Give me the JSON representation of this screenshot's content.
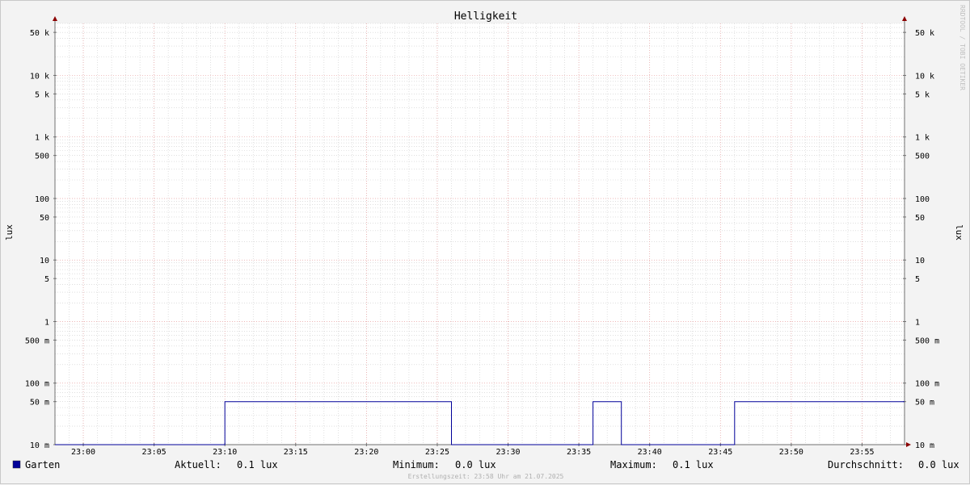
{
  "chart_data": {
    "type": "line",
    "title": "Helligkeit",
    "ylabel": "lux",
    "yscale": "log",
    "ylim": [
      0.01,
      70000
    ],
    "grid": true,
    "y_tick_labels": [
      {
        "value": 50000,
        "label": "50 k"
      },
      {
        "value": 10000,
        "label": "10 k"
      },
      {
        "value": 5000,
        "label": "5 k"
      },
      {
        "value": 1000,
        "label": "1 k"
      },
      {
        "value": 500,
        "label": "500"
      },
      {
        "value": 100,
        "label": "100"
      },
      {
        "value": 50,
        "label": "50"
      },
      {
        "value": 10,
        "label": "10"
      },
      {
        "value": 5,
        "label": "5"
      },
      {
        "value": 1,
        "label": "1"
      },
      {
        "value": 0.5,
        "label": "500 m"
      },
      {
        "value": 0.1,
        "label": "100 m"
      },
      {
        "value": 0.05,
        "label": "50 m"
      },
      {
        "value": 0.01,
        "label": "10 m"
      }
    ],
    "x_tick_labels": [
      "23:00",
      "23:05",
      "23:10",
      "23:15",
      "23:20",
      "23:25",
      "23:30",
      "23:35",
      "23:40",
      "23:45",
      "23:50",
      "23:55"
    ],
    "series": [
      {
        "name": "Garten",
        "color": "#000099",
        "points": [
          [
            "22:58",
            0.01
          ],
          [
            "23:10",
            0.01
          ],
          [
            "23:10",
            0.05
          ],
          [
            "23:26",
            0.05
          ],
          [
            "23:26",
            0.01
          ],
          [
            "23:36",
            0.01
          ],
          [
            "23:36",
            0.05
          ],
          [
            "23:38",
            0.05
          ],
          [
            "23:38",
            0.01
          ],
          [
            "23:46",
            0.01
          ],
          [
            "23:46",
            0.05
          ],
          [
            "23:58",
            0.05
          ]
        ]
      }
    ]
  },
  "legend": {
    "series_name": "Garten",
    "swatch_color": "#000099",
    "current_label": "Aktuell:",
    "current_value": "0.1 lux",
    "min_label": "Minimum:",
    "min_value": "0.0 lux",
    "max_label": "Maximum:",
    "max_value": "0.1 lux",
    "avg_label": "Durchschnitt:",
    "avg_value": "0.0 lux"
  },
  "footer": "Erstellungszeit: 23:58 Uhr am 21.07.2025",
  "watermark": "RRDTOOL / TOBI OETIKER",
  "colors": {
    "background": "#f3f3f3",
    "plot": "#ffffff",
    "major_grid": "#e8a0a0",
    "minor_grid": "#cccccc",
    "axis": "#707070",
    "arrow": "#8b0000",
    "line": "#000099"
  }
}
